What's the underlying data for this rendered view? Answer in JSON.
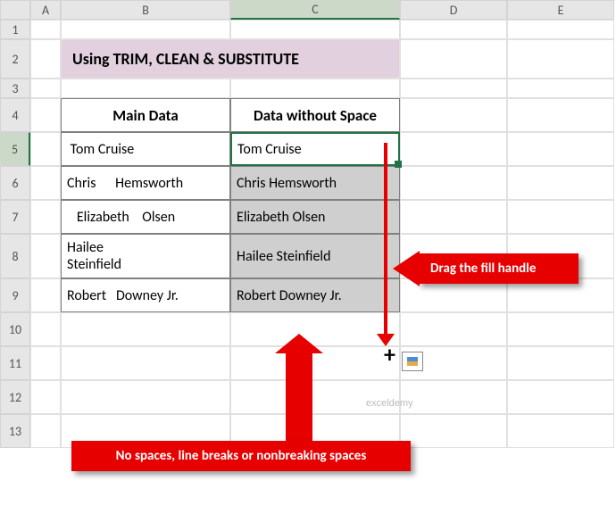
{
  "columns": [
    "A",
    "B",
    "C",
    "D",
    "E"
  ],
  "rows": [
    "1",
    "2",
    "3",
    "4",
    "5",
    "6",
    "7",
    "8",
    "9",
    "10",
    "11",
    "12",
    "13"
  ],
  "title": "Using TRIM, CLEAN & SUBSTITUTE",
  "headers": {
    "main": "Main Data",
    "result": "Data without Space"
  },
  "data": [
    {
      "main": " Tom Cruise",
      "result": "Tom Cruise"
    },
    {
      "main": "Chris      Hemsworth",
      "result": "Chris Hemsworth"
    },
    {
      "main": "   Elizabeth    Olsen",
      "result": "Elizabeth Olsen"
    },
    {
      "main": " Hailee\nSteinfield",
      "result": "Hailee Steinfield"
    },
    {
      "main": "Robert   Downey Jr.",
      "result": "Robert Downey Jr."
    }
  ],
  "callouts": {
    "drag": "Drag the fill handle",
    "nospaces": "No spaces, line breaks or nonbreaking spaces"
  },
  "watermark": "exceldemy",
  "icons": {
    "cursor": "+"
  },
  "chart_data": {
    "type": "table",
    "title": "Using TRIM, CLEAN & SUBSTITUTE",
    "columns": [
      "Main Data",
      "Data without Space"
    ],
    "rows": [
      [
        " Tom Cruise",
        "Tom Cruise"
      ],
      [
        "Chris      Hemsworth",
        "Chris Hemsworth"
      ],
      [
        "   Elizabeth    Olsen",
        "Elizabeth Olsen"
      ],
      [
        " Hailee\nSteinfield",
        "Hailee Steinfield"
      ],
      [
        "Robert   Downey Jr.",
        "Robert Downey Jr."
      ]
    ]
  }
}
